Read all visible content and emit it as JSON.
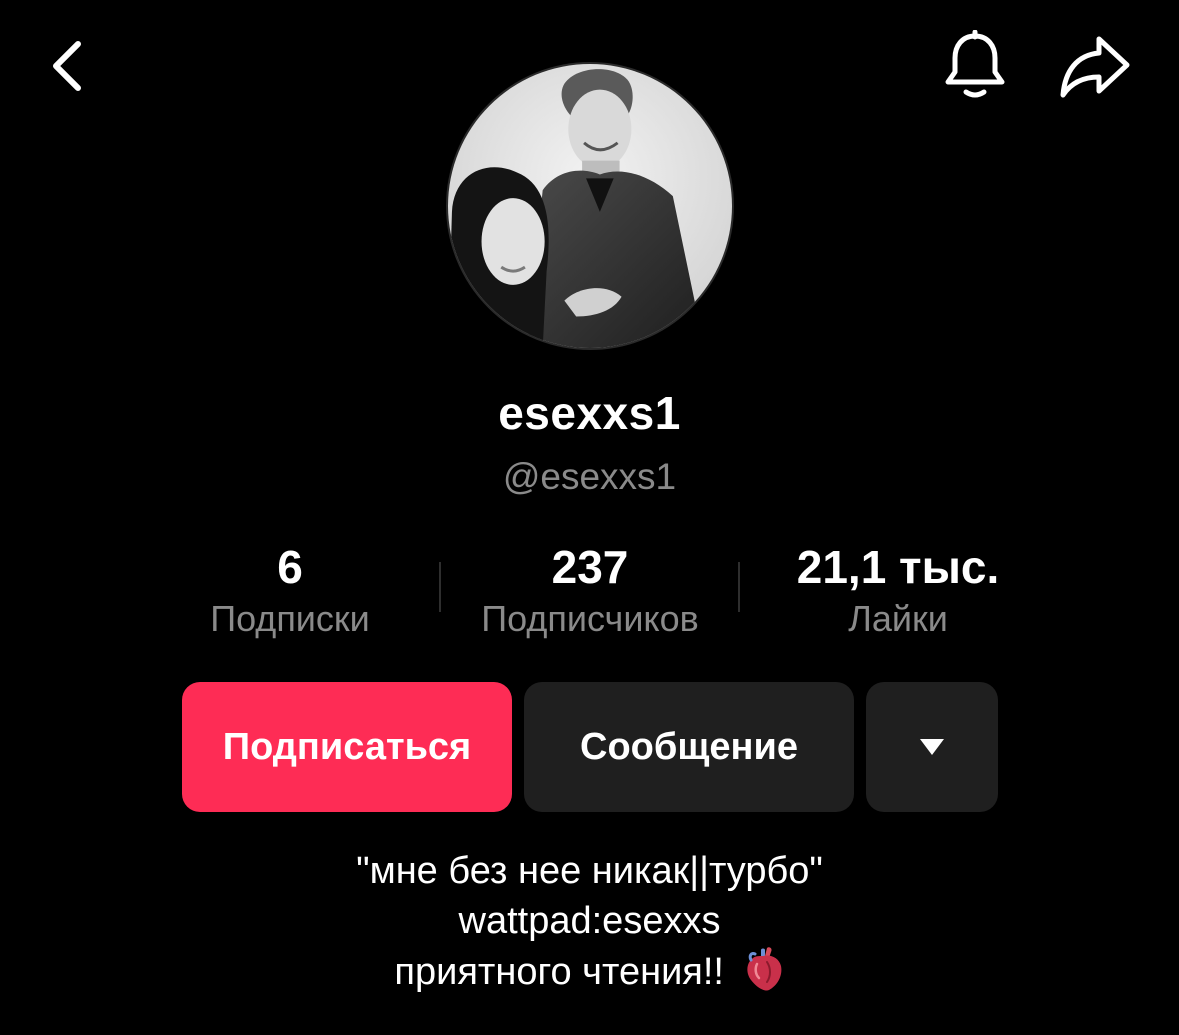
{
  "topbar": {
    "back_icon": "chevron-left-icon",
    "bell_icon": "bell-icon",
    "share_icon": "share-arrow-icon"
  },
  "profile": {
    "display_name": "esexxs1",
    "handle": "@esexxs1"
  },
  "stats": {
    "following": {
      "value": "6",
      "label": "Подписки"
    },
    "followers": {
      "value": "237",
      "label": "Подписчиков"
    },
    "likes": {
      "value": "21,1 тыс.",
      "label": "Лайки"
    }
  },
  "actions": {
    "follow_label": "Подписаться",
    "message_label": "Сообщение",
    "more_icon": "triangle-down-icon"
  },
  "bio": {
    "line1": "\"мне без нее никак||турбо\"",
    "line2": "wattpad:esexxs",
    "line3": "приятного чтения!!",
    "emoji_icon": "anatomical-heart-icon"
  },
  "colors": {
    "background": "#000000",
    "accent": "#fe2c55",
    "secondary_button": "#1f1f1f",
    "muted_text": "#8a8a8a"
  }
}
